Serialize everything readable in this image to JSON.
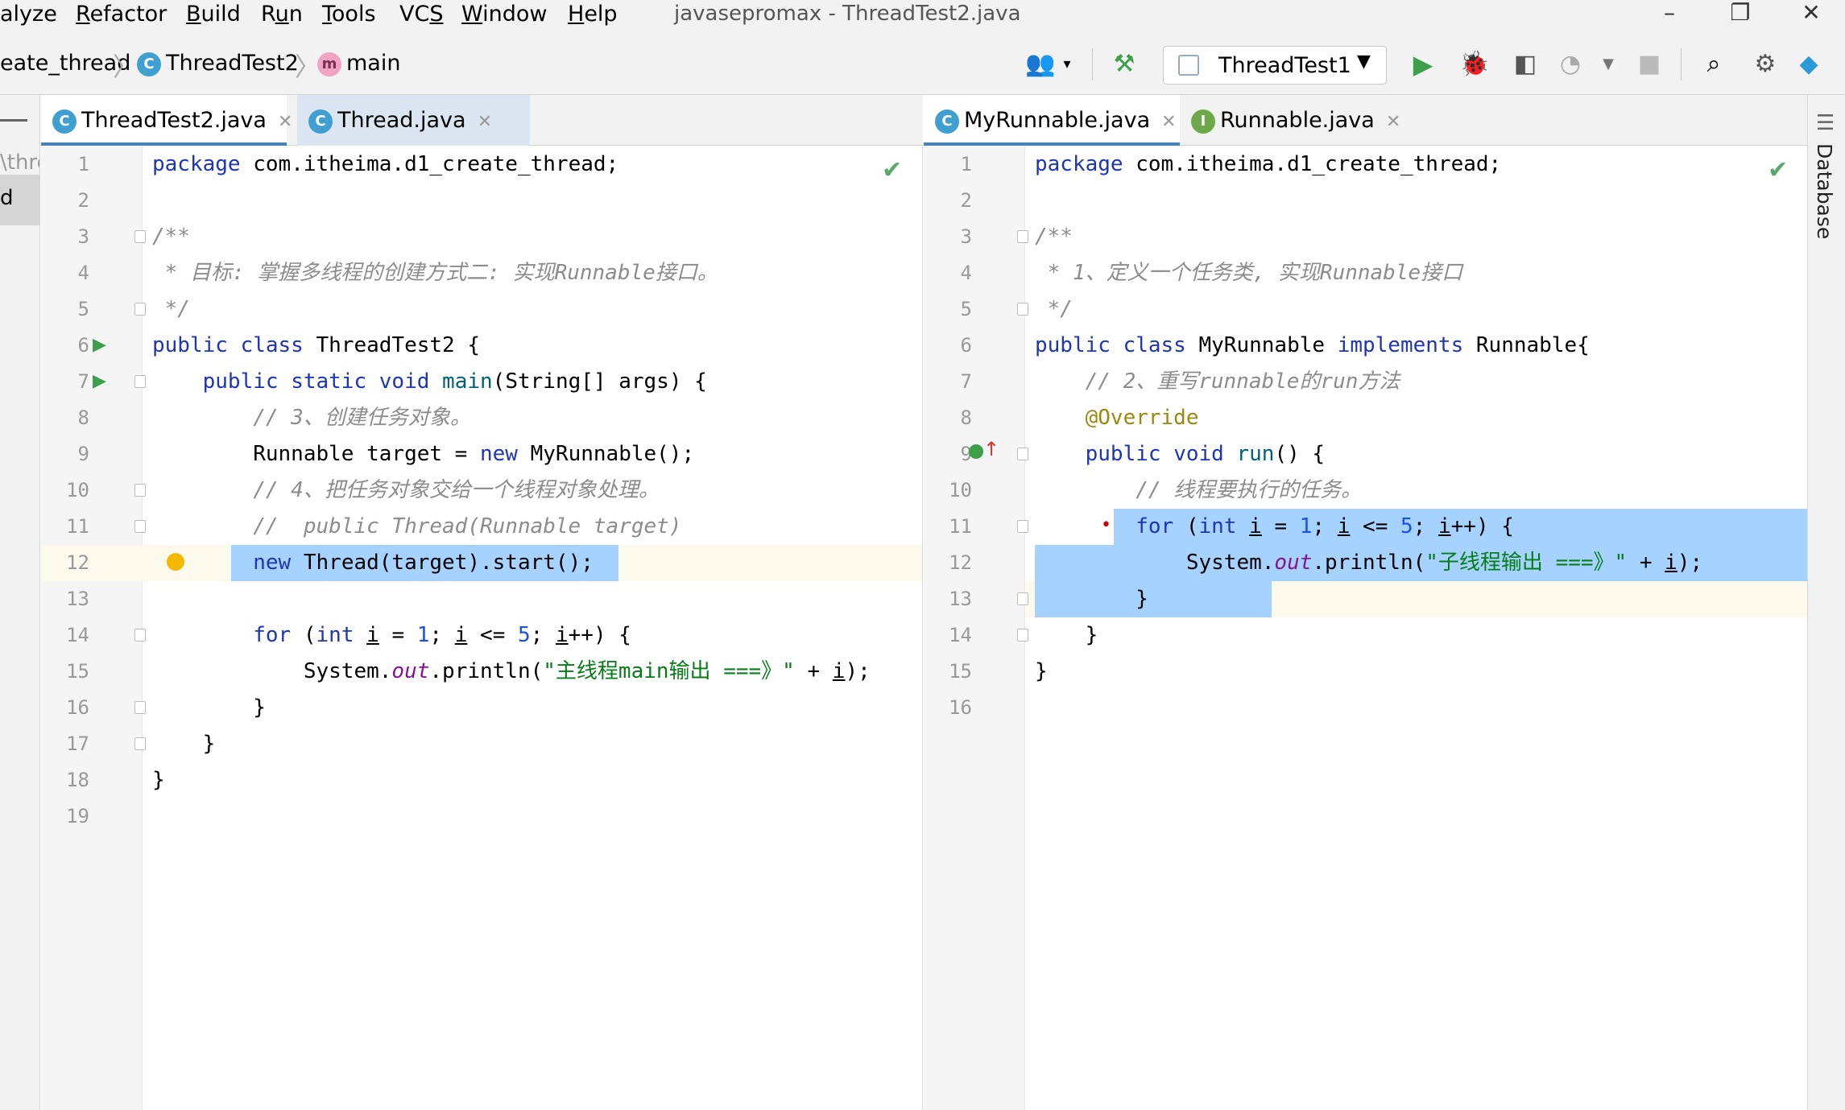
{
  "menu": {
    "items": [
      {
        "label": "alyze",
        "u": ""
      },
      {
        "label": "Refactor",
        "u": "R"
      },
      {
        "label": "Build",
        "u": "B"
      },
      {
        "label": "Run",
        "u": "u"
      },
      {
        "label": "Tools",
        "u": "T"
      },
      {
        "label": "VCS",
        "u": "S"
      },
      {
        "label": "Window",
        "u": "W"
      },
      {
        "label": "Help",
        "u": "H"
      }
    ],
    "window_title": "javasepromax - ThreadTest2.java"
  },
  "nav": {
    "crumb_package": "eate_thread",
    "crumb_class": "ThreadTest2",
    "crumb_method": "main",
    "run_config": "ThreadTest1"
  },
  "sidebar": {
    "fragment_1": "\\thre",
    "fragment_2": "d",
    "database_label": "Database"
  },
  "left_pane": {
    "tabs": [
      {
        "label": "ThreadTest2.java",
        "active": true
      },
      {
        "label": "Thread.java",
        "active": false
      }
    ]
  },
  "right_pane": {
    "tabs": [
      {
        "label": "MyRunnable.java",
        "active": true
      },
      {
        "label": "Runnable.java",
        "active": false
      }
    ]
  },
  "colors": {
    "keyword": "#1e35b8",
    "comment": "#8c8c8c",
    "string": "#067d17",
    "number": "#1750eb",
    "selection": "#a6d2ff",
    "tab_active_underline": "#4083c9"
  }
}
